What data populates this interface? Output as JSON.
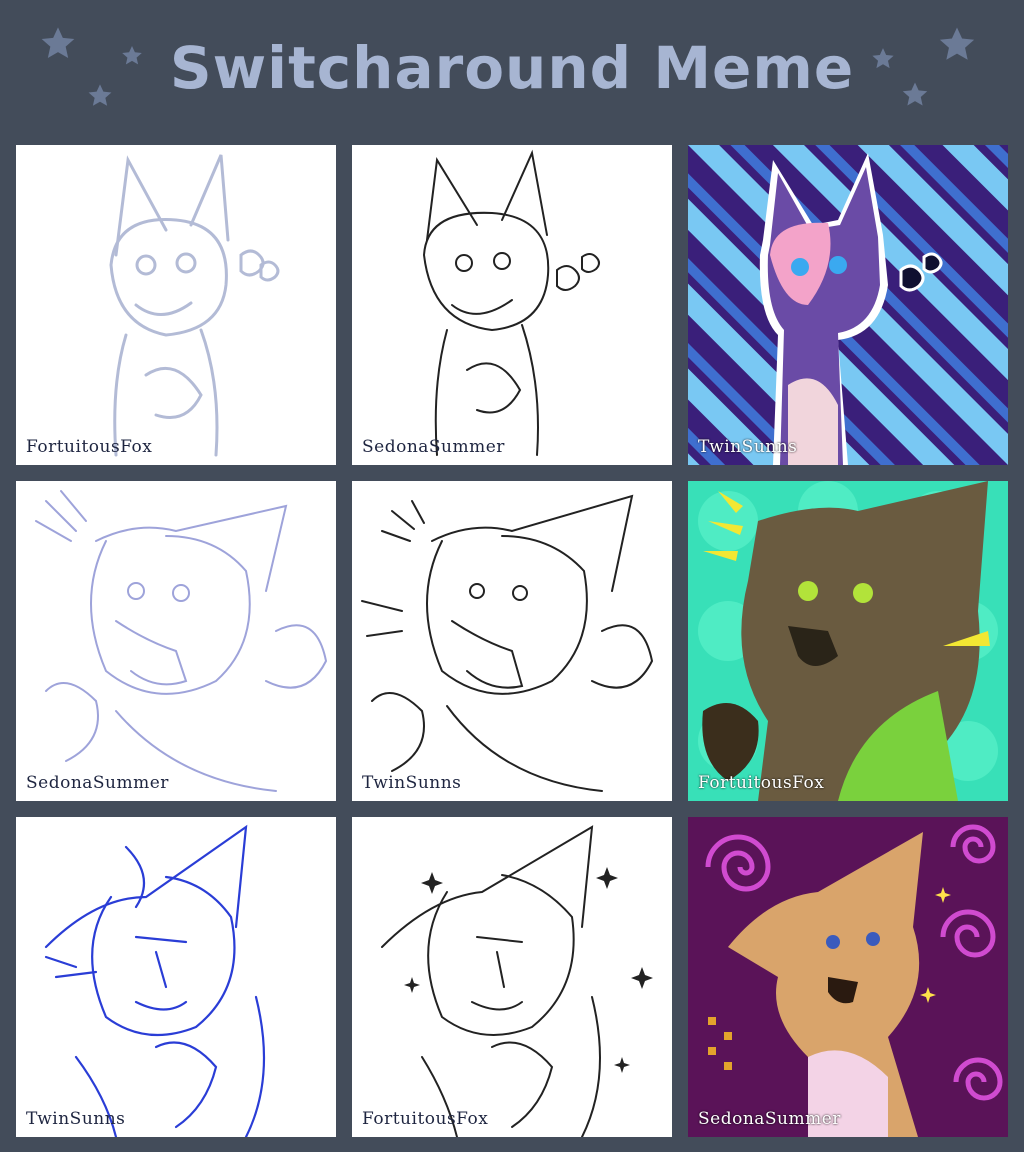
{
  "title": "Switcharound Meme",
  "colors": {
    "background": "#434c5a",
    "title": "#a7b5d2",
    "star": "#6b7a96"
  },
  "panels": [
    {
      "signature": "FortuitousFox",
      "stage": "sketch",
      "sketch_color": "#b3bbd6"
    },
    {
      "signature": "SedonaSummer",
      "stage": "lineart"
    },
    {
      "signature": "TwinSunns",
      "stage": "color",
      "background": "#3a1f7a",
      "stripes": "#79c8f3"
    },
    {
      "signature": "SedonaSummer",
      "stage": "sketch",
      "sketch_color": "#9ea3da"
    },
    {
      "signature": "TwinSunns",
      "stage": "lineart"
    },
    {
      "signature": "FortuitousFox",
      "stage": "color",
      "background": "#38e0b8"
    },
    {
      "signature": "TwinSunns",
      "stage": "sketch",
      "sketch_color": "#2a3dd6"
    },
    {
      "signature": "FortuitousFox",
      "stage": "lineart"
    },
    {
      "signature": "SedonaSummer",
      "stage": "color",
      "background": "#5a1358",
      "swirls": "#d04bd0"
    }
  ]
}
